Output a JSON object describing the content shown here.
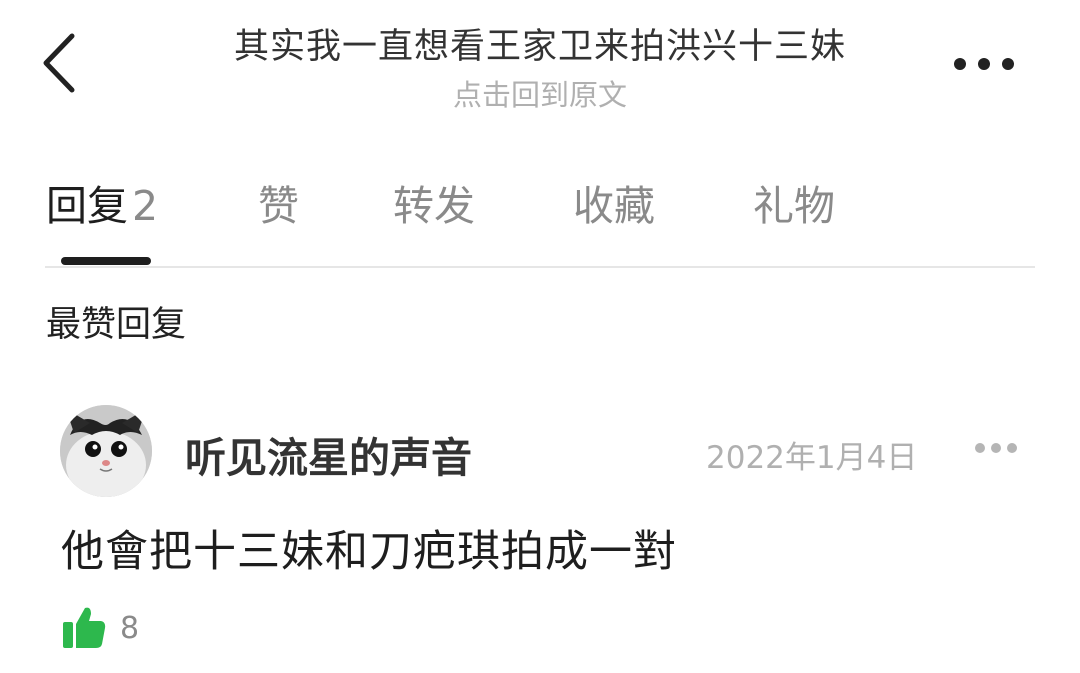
{
  "header": {
    "title": "其实我一直想看王家卫来拍洪兴十三妹",
    "subtitle": "点击回到原文"
  },
  "tabs": [
    {
      "label": "回复",
      "count": "2",
      "active": true
    },
    {
      "label": "赞"
    },
    {
      "label": "转发"
    },
    {
      "label": "收藏"
    },
    {
      "label": "礼物"
    }
  ],
  "section": {
    "label": "最赞回复"
  },
  "comment": {
    "username": "听见流星的声音",
    "date": "2022年1月4日",
    "text": "他會把十三妹和刀疤琪拍成一對",
    "likes": "8"
  },
  "colors": {
    "like_green": "#2db84d",
    "muted": "#8a8a8a",
    "light": "#b0b0b0"
  }
}
